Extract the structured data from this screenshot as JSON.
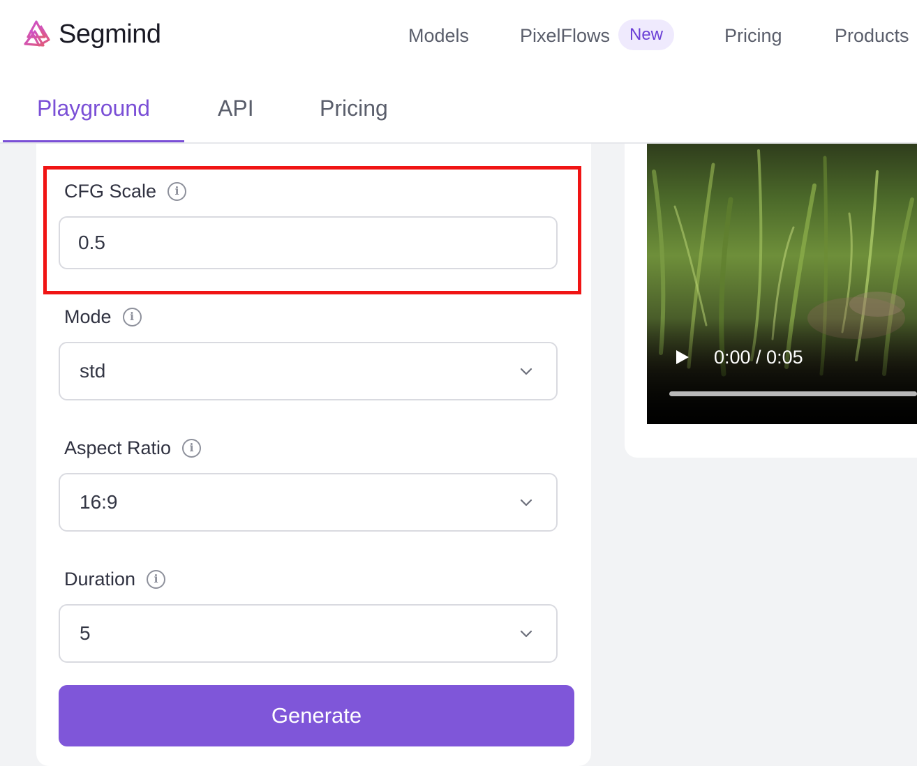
{
  "brand": {
    "name": "Segmind"
  },
  "nav": {
    "models": "Models",
    "pixelflows": "PixelFlows",
    "new_badge": "New",
    "pricing": "Pricing",
    "products": "Products"
  },
  "tabs": {
    "playground": "Playground",
    "api": "API",
    "pricing": "Pricing",
    "active": "Playground"
  },
  "form": {
    "cfg_scale": {
      "label": "CFG Scale",
      "value": "0.5"
    },
    "mode": {
      "label": "Mode",
      "value": "std"
    },
    "aspect_ratio": {
      "label": "Aspect Ratio",
      "value": "16:9"
    },
    "duration": {
      "label": "Duration",
      "value": "5"
    },
    "generate_label": "Generate"
  },
  "video": {
    "time": "0:00 / 0:05"
  },
  "colors": {
    "accent": "#7f56d9",
    "highlight": "#f01414"
  },
  "icons": [
    "segmind-logo-icon",
    "info-icon",
    "chevron-down-icon",
    "play-icon"
  ]
}
